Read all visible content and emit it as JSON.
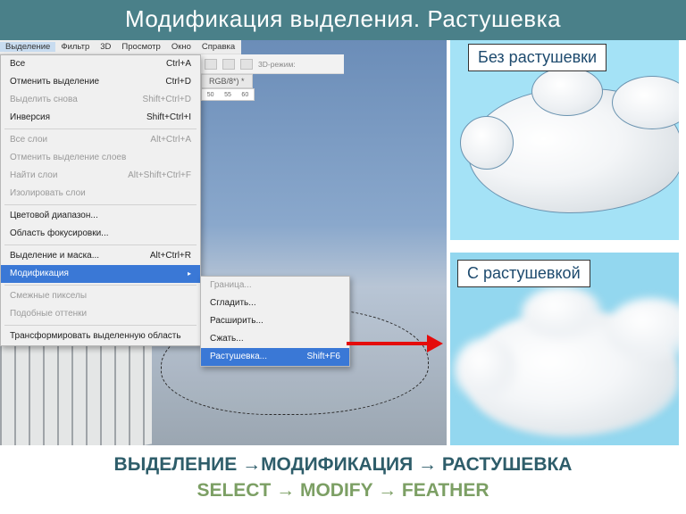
{
  "title": "Модификация выделения. Растушевка",
  "menubar": {
    "items": [
      "Выделение",
      "Фильтр",
      "3D",
      "Просмотр",
      "Окно",
      "Справка"
    ],
    "selected": "Выделение"
  },
  "toolbar": {
    "mode_label": "3D-режим:"
  },
  "doc_tab": "RGB/8*) *",
  "ruler_marks": [
    "50",
    "55",
    "60"
  ],
  "dropdown": {
    "sections": [
      [
        {
          "label": "Все",
          "shortcut": "Ctrl+A",
          "disabled": false
        },
        {
          "label": "Отменить выделение",
          "shortcut": "Ctrl+D",
          "disabled": false
        },
        {
          "label": "Выделить снова",
          "shortcut": "Shift+Ctrl+D",
          "disabled": true
        },
        {
          "label": "Инверсия",
          "shortcut": "Shift+Ctrl+I",
          "disabled": false
        }
      ],
      [
        {
          "label": "Все слои",
          "shortcut": "Alt+Ctrl+A",
          "disabled": true
        },
        {
          "label": "Отменить выделение слоев",
          "shortcut": "",
          "disabled": true
        },
        {
          "label": "Найти слои",
          "shortcut": "Alt+Shift+Ctrl+F",
          "disabled": true
        },
        {
          "label": "Изолировать слои",
          "shortcut": "",
          "disabled": true
        }
      ],
      [
        {
          "label": "Цветовой диапазон...",
          "shortcut": "",
          "disabled": false
        },
        {
          "label": "Область фокусировки...",
          "shortcut": "",
          "disabled": false
        }
      ],
      [
        {
          "label": "Выделение и маска...",
          "shortcut": "Alt+Ctrl+R",
          "disabled": false
        },
        {
          "label": "Модификация",
          "shortcut": "",
          "disabled": false,
          "submenu": true,
          "highlight": true
        }
      ],
      [
        {
          "label": "Смежные пикселы",
          "shortcut": "",
          "disabled": true
        },
        {
          "label": "Подобные оттенки",
          "shortcut": "",
          "disabled": true
        }
      ],
      [
        {
          "label": "Трансформировать выделенную область",
          "shortcut": "",
          "disabled": false
        }
      ]
    ]
  },
  "submenu": {
    "items": [
      {
        "label": "Граница...",
        "shortcut": "",
        "disabled": true
      },
      {
        "label": "Сгладить...",
        "shortcut": "",
        "disabled": false
      },
      {
        "label": "Расширить...",
        "shortcut": "",
        "disabled": false
      },
      {
        "label": "Сжать...",
        "shortcut": "",
        "disabled": false
      },
      {
        "label": "Растушевка...",
        "shortcut": "Shift+F6",
        "disabled": false,
        "highlight": true
      }
    ]
  },
  "panels": {
    "no_feather": "Без растушевки",
    "with_feather": "С  растушевкой"
  },
  "footer": {
    "ru": "ВЫДЕЛЕНИЕ →МОДИФИКАЦИЯ → РАСТУШЕВКА",
    "en": "SELECT → MODIFY → FEATHER"
  }
}
